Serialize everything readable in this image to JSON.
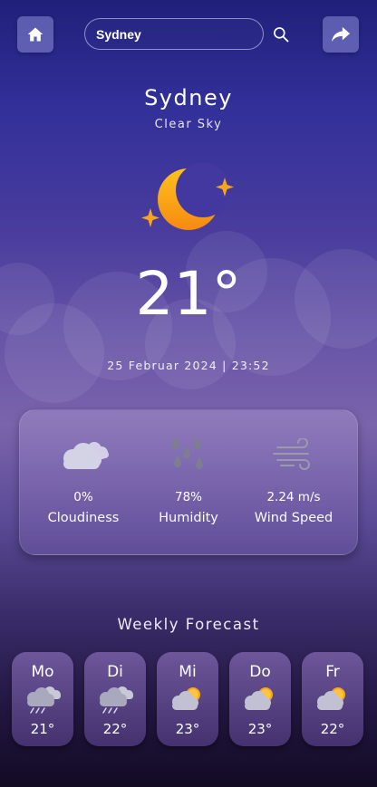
{
  "header": {
    "home_icon": "home-icon",
    "share_icon": "share-arrow-icon",
    "search_icon": "search-icon",
    "search_value": "Sydney"
  },
  "current": {
    "city": "Sydney",
    "condition": "Clear Sky",
    "condition_icon": "moon-stars-icon",
    "temperature": "21°",
    "datetime": "25 Februar 2024 | 23:52"
  },
  "stats": [
    {
      "icon": "cloud-icon",
      "value": "0%",
      "label": "Cloudiness"
    },
    {
      "icon": "raindrops-icon",
      "value": "78%",
      "label": "Humidity"
    },
    {
      "icon": "wind-icon",
      "value": "2.24 m/s",
      "label": "Wind Speed"
    }
  ],
  "weekly": {
    "title": "Weekly Forecast",
    "days": [
      {
        "name": "Mo",
        "icon": "rain-cloud-icon",
        "temp": "21°"
      },
      {
        "name": "Di",
        "icon": "rain-cloud-icon",
        "temp": "22°"
      },
      {
        "name": "Mi",
        "icon": "sun-cloud-icon",
        "temp": "23°"
      },
      {
        "name": "Do",
        "icon": "sun-cloud-icon",
        "temp": "23°"
      },
      {
        "name": "Fr",
        "icon": "sun-cloud-icon",
        "temp": "22°"
      }
    ]
  },
  "colors": {
    "accent": "#f7a51c",
    "button_bg": "#8c8cd7"
  }
}
